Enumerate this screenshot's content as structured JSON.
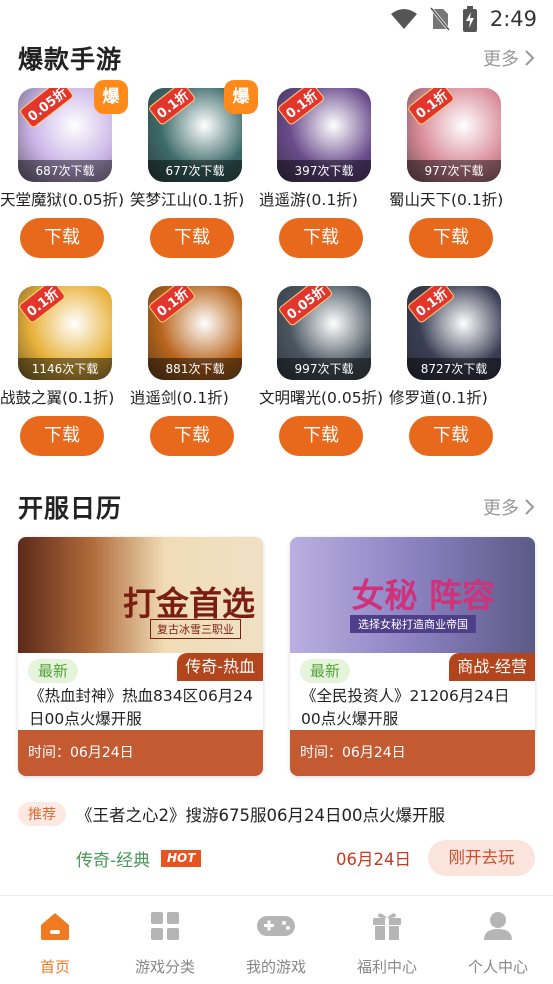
{
  "status_bar": {
    "time": "2:49"
  },
  "hot_games": {
    "title": "爆款手游",
    "more": "更多",
    "download_label": "下载",
    "hot_badge": "爆",
    "rows": [
      [
        {
          "name": "天堂魔狱(0.05折)",
          "downloads": "687次下载",
          "discount": "0.05折",
          "hot": true,
          "color": "#c9b3e6"
        },
        {
          "name": "笑梦江山(0.1折)",
          "downloads": "677次下载",
          "discount": "0.1折",
          "hot": true,
          "color": "#3d6b6a"
        },
        {
          "name": "逍遥游(0.1折)",
          "downloads": "397次下载",
          "discount": "0.1折",
          "hot": false,
          "color": "#6a4b8c"
        },
        {
          "name": "蜀山天下(0.1折)",
          "downloads": "977次下载",
          "discount": "0.1折",
          "hot": false,
          "color": "#d98c9a"
        }
      ],
      [
        {
          "name": "战鼓之翼(0.1折)",
          "downloads": "1146次下载",
          "discount": "0.1折",
          "hot": false,
          "color": "#e8b23a"
        },
        {
          "name": "逍遥剑(0.1折)",
          "downloads": "881次下载",
          "discount": "0.1折",
          "hot": false,
          "color": "#b8651c"
        },
        {
          "name": "文明曙光(0.05折)",
          "downloads": "997次下载",
          "discount": "0.05折",
          "hot": false,
          "color": "#4a5660"
        },
        {
          "name": "修罗道(0.1折)",
          "downloads": "8727次下载",
          "discount": "0.1折",
          "hot": false,
          "color": "#3a3e54"
        }
      ]
    ]
  },
  "calendar": {
    "title": "开服日历",
    "more": "更多",
    "cards": [
      {
        "banner_text": "打金首选",
        "banner_sub": "复古冰雪三职业",
        "genre": "传奇-热血",
        "tag": "最新",
        "desc": "《热血封神》热血834区06月24日00点火爆开服",
        "time": "时间：06月24日",
        "bg": "#d8a56a",
        "text_color": "#7a1e12"
      },
      {
        "banner_text": "女秘 阵容",
        "banner_sub": "选择女秘打造商业帝国",
        "genre": "商战-经营",
        "tag": "最新",
        "desc": "《全民投资人》21206月24日00点火爆开服",
        "time": "时间：06月24日",
        "bg": "#9a90c9",
        "text_color": "#d0317a"
      }
    ]
  },
  "notice": {
    "tag": "推荐",
    "text": "《王者之心2》搜游675服06月24日00点火爆开服",
    "genre": "传奇-经典",
    "hot": "HOT",
    "date": "06月24日",
    "button": "刚开去玩"
  },
  "tabbar": {
    "items": [
      {
        "label": "首页",
        "icon": "home-icon",
        "active": true
      },
      {
        "label": "游戏分类",
        "icon": "grid-icon",
        "active": false
      },
      {
        "label": "我的游戏",
        "icon": "gamepad-icon",
        "active": false
      },
      {
        "label": "福利中心",
        "icon": "gift-icon",
        "active": false
      },
      {
        "label": "个人中心",
        "icon": "user-icon",
        "active": false
      }
    ],
    "active_color": "#f07a22",
    "inactive_color": "#b5b5b5"
  }
}
